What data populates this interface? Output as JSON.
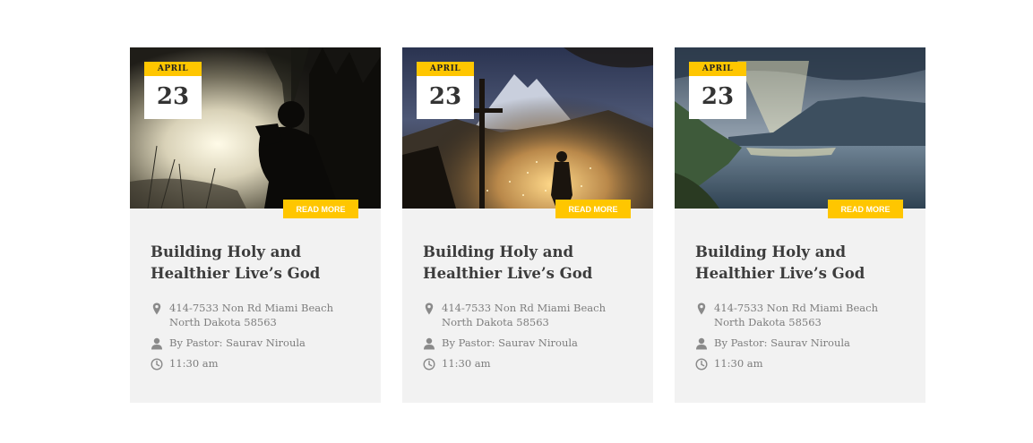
{
  "cards": [
    {
      "date": {
        "month": "April",
        "day": "23"
      },
      "read_more": "READ MORE",
      "title": "Building Holy and Healthier Live’s God",
      "address": "414-7533 Non Rd Miami Beach North Dakota 58563",
      "pastor": "By Pastor: Saurav Niroula",
      "time": "11:30 am",
      "image": "man-praying-in-misty-forest"
    },
    {
      "date": {
        "month": "April",
        "day": "23"
      },
      "read_more": "READ MORE",
      "title": "Building Holy and Healthier Live’s God",
      "address": "414-7533 Non Rd Miami Beach North Dakota 58563",
      "pastor": "By Pastor: Saurav Niroula",
      "time": "11:30 am",
      "image": "cross-over-mountain-town-at-night"
    },
    {
      "date": {
        "month": "April",
        "day": "23"
      },
      "read_more": "READ MORE",
      "title": "Building Holy and Healthier Live’s God",
      "address": "414-7533 Non Rd Miami Beach North Dakota 58563",
      "pastor": "By Pastor: Saurav Niroula",
      "time": "11:30 am",
      "image": "sun-rays-over-fjord"
    }
  ],
  "colors": {
    "accent": "#ffc600",
    "card_bg": "#f2f2f2",
    "title": "#3c3c3c",
    "meta": "#7d7d7d",
    "icon": "#8a8a8a"
  },
  "icons": {
    "address": "map-pin-icon",
    "pastor": "user-icon",
    "time": "clock-icon"
  }
}
